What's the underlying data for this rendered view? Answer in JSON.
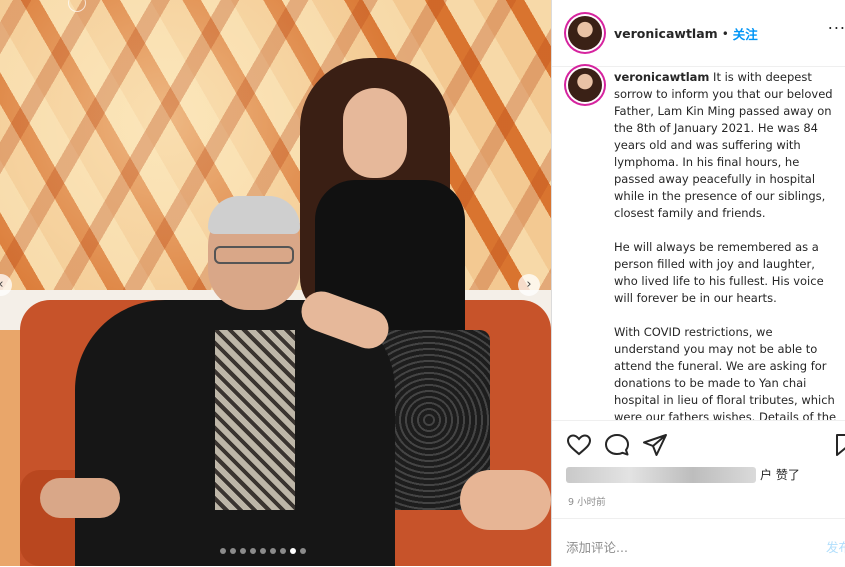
{
  "post": {
    "username": "veronicawtlam",
    "follow_label": "关注",
    "separator": "•",
    "more_label": "...",
    "caption_paragraphs": [
      "It is with deepest sorrow to inform you that our beloved Father, Lam Kin Ming passed away on the 8th of January 2021. He was 84 years old and was suffering with lymphoma. In his final hours, he passed away peacefully in hospital while in the presence of our siblings, closest family and friends.",
      "He will always be remembered as a person filled with joy and laughter, who lived life to his fullest. His voice will forever be in our hearts.",
      "With COVID restrictions, we understand you may not be able to attend the funeral. We are asking for donations to be made to Yan chai hospital in lieu of floral tributes, which were our fathers wishes. Details of the"
    ],
    "likes_suffix": "户 赞了",
    "time_ago": "9 小时前",
    "comment_placeholder": "添加评论...",
    "post_label": "发布"
  },
  "carousel": {
    "prev_icon": "chevron-left-icon",
    "next_icon": "chevron-right-icon",
    "prev_glyph": "‹",
    "next_glyph": "›",
    "slide_count": 9,
    "active_slide": 8
  },
  "icons": [
    "heart-icon",
    "comment-icon",
    "share-icon",
    "bookmark-icon"
  ],
  "colors": {
    "accent": "#0095f6",
    "text": "#262626",
    "muted": "#8e8e8e",
    "story_ring": "#d6249f"
  }
}
